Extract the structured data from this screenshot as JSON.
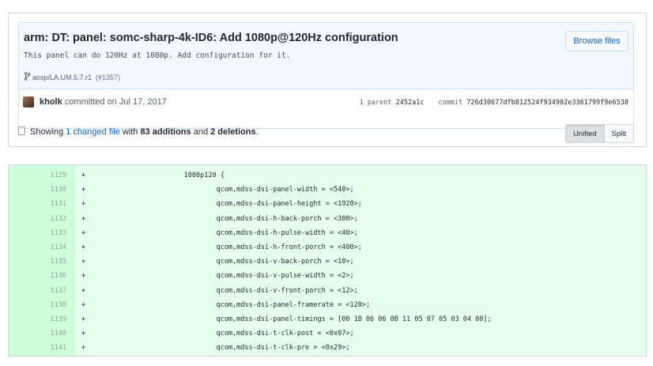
{
  "commit": {
    "title": "arm: DT: panel: somc-sharp-4k-ID6: Add 1080p@120Hz configuration",
    "description": "This panel can do 120Hz at 1080p. Add configuration for it.",
    "browse_files_label": "Browse files",
    "branch": "aosp/LA.UM.5.7.r1",
    "pr_ref": "(#1357)",
    "author": "kholk",
    "committed_text": "committed on Jul 17, 2017",
    "parent_label": "1 parent",
    "parent_sha": "2452a1c",
    "commit_label": "commit",
    "commit_sha": "726d30677dfb812524f934902e3361799f9e6538"
  },
  "toc": {
    "showing": "Showing",
    "changed_files": "1 changed file",
    "with": "with",
    "additions": "83 additions",
    "and": "and",
    "deletions": "2 deletions",
    "period": ".",
    "unified_label": "Unified",
    "split_label": "Split"
  },
  "diff": {
    "lines": [
      {
        "num": "1129",
        "sign": "+",
        "code": "              1080p120 {"
      },
      {
        "num": "1130",
        "sign": "+",
        "code": "                      qcom,mdss-dsi-panel-width = <540>;"
      },
      {
        "num": "1131",
        "sign": "+",
        "code": "                      qcom,mdss-dsi-panel-height = <1920>;"
      },
      {
        "num": "1132",
        "sign": "+",
        "code": "                      qcom,mdss-dsi-h-back-porch = <300>;"
      },
      {
        "num": "1133",
        "sign": "+",
        "code": "                      qcom,mdss-dsi-h-pulse-width = <40>;"
      },
      {
        "num": "1134",
        "sign": "+",
        "code": "                      qcom,mdss-dsi-h-front-porch = <400>;"
      },
      {
        "num": "1135",
        "sign": "+",
        "code": "                      qcom,mdss-dsi-v-back-porch = <10>;"
      },
      {
        "num": "1136",
        "sign": "+",
        "code": "                      qcom,mdss-dsi-v-pulse-width = <2>;"
      },
      {
        "num": "1137",
        "sign": "+",
        "code": "                      qcom,mdss-dsi-v-front-porch = <12>;"
      },
      {
        "num": "1138",
        "sign": "+",
        "code": "                      qcom,mdss-dsi-panel-framerate = <120>;"
      },
      {
        "num": "1139",
        "sign": "+",
        "code": "                      qcom,mdss-dsi-panel-timings = [00 1B 06 06 0B 11 05 07 05 03 04 00];"
      },
      {
        "num": "1140",
        "sign": "+",
        "code": "                      qcom,mdss-dsi-t-clk-post = <0x07>;"
      },
      {
        "num": "1141",
        "sign": "+",
        "code": "                      qcom,mdss-dsi-t-clk-pre = <0x29>;"
      }
    ]
  },
  "icons": {
    "branch": "git-branch-icon",
    "file_toc": "file-diff-icon"
  },
  "colors": {
    "link": "#0366d6",
    "addition_bg": "#e6ffed",
    "addition_gutter": "#cdffd8",
    "commit_header_bg": "#f1f8ff"
  }
}
